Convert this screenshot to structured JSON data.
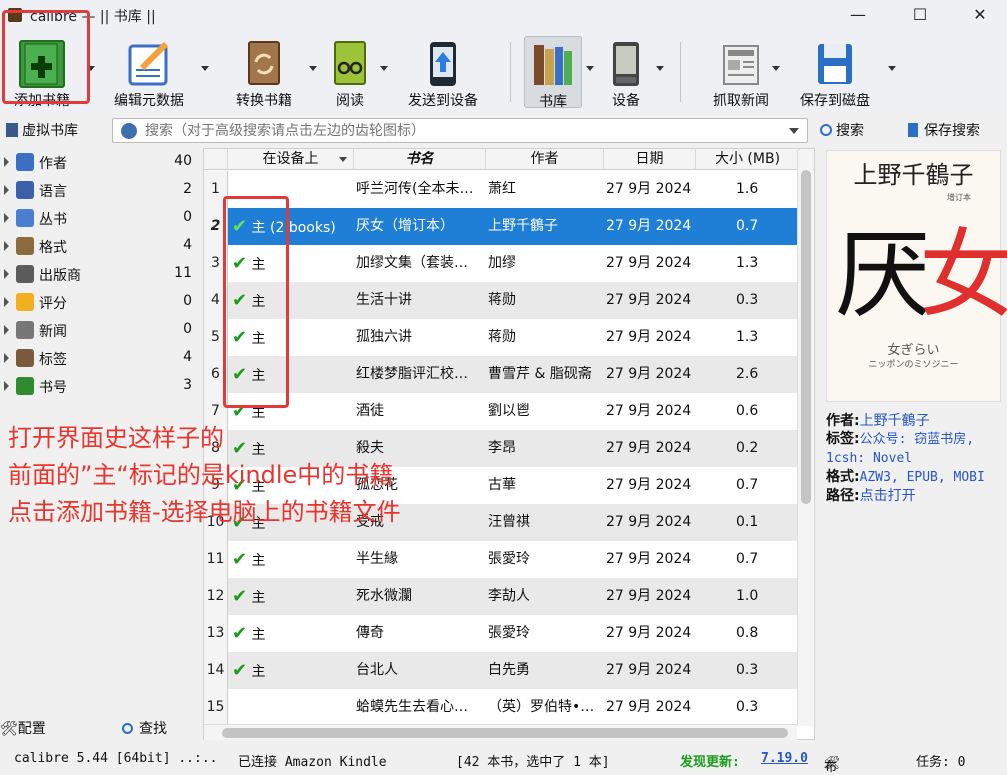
{
  "window": {
    "title": "calibre — || 书库 ||",
    "min": "—",
    "max": "☐",
    "close": "✕"
  },
  "toolbar": [
    {
      "id": "add",
      "label": "添加书籍",
      "icon": "add-book-icon"
    },
    {
      "id": "edit",
      "label": "编辑元数据",
      "icon": "edit-metadata-icon"
    },
    {
      "id": "convert",
      "label": "转换书籍",
      "icon": "convert-book-icon"
    },
    {
      "id": "view",
      "label": "阅读",
      "icon": "read-book-icon"
    },
    {
      "id": "send",
      "label": "发送到设备",
      "icon": "send-to-device-icon"
    },
    {
      "id": "library",
      "label": "书库",
      "icon": "library-icon"
    },
    {
      "id": "device",
      "label": "设备",
      "icon": "device-icon"
    },
    {
      "id": "news",
      "label": "抓取新闻",
      "icon": "news-icon"
    },
    {
      "id": "save",
      "label": "保存到磁盘",
      "icon": "save-disk-icon"
    }
  ],
  "search": {
    "virtual_library": "虚拟书库",
    "placeholder": "搜索（对于高级搜索请点击左边的齿轮图标）",
    "search_btn": "搜索",
    "saved_btn": "保存搜索"
  },
  "tags": [
    {
      "label": "作者",
      "count": "40",
      "color": "#3a6fc4"
    },
    {
      "label": "语言",
      "count": "2",
      "color": "#3b5fa8"
    },
    {
      "label": "丛书",
      "count": "0",
      "color": "#4a7ed0"
    },
    {
      "label": "格式",
      "count": "4",
      "color": "#8b6a3f"
    },
    {
      "label": "出版商",
      "count": "11",
      "color": "#5b5b5b"
    },
    {
      "label": "评分",
      "count": "0",
      "color": "#f2b01e"
    },
    {
      "label": "新闻",
      "count": "0",
      "color": "#777777"
    },
    {
      "label": "标签",
      "count": "4",
      "color": "#7a5a3a"
    },
    {
      "label": "书号",
      "count": "3",
      "color": "#2e8b2e"
    }
  ],
  "columns": {
    "device": "在设备上",
    "title": "书名",
    "author": "作者",
    "date": "日期",
    "size": "大小 (MB)"
  },
  "books": [
    {
      "n": "1",
      "dev": "",
      "title": "呼兰河传(全本未…",
      "author": "萧红",
      "date": "27 9月 2024",
      "size": "1.6"
    },
    {
      "n": "2",
      "dev": "主 (2 books)",
      "title": "厌女（增订本）",
      "author": "上野千鶴子",
      "date": "27 9月 2024",
      "size": "0.7"
    },
    {
      "n": "3",
      "dev": "主",
      "title": "加缪文集（套装…",
      "author": "加缪",
      "date": "27 9月 2024",
      "size": "1.3"
    },
    {
      "n": "4",
      "dev": "主",
      "title": "生活十讲",
      "author": "蒋勋",
      "date": "27 9月 2024",
      "size": "0.3"
    },
    {
      "n": "5",
      "dev": "主",
      "title": "孤独六讲",
      "author": "蒋勋",
      "date": "27 9月 2024",
      "size": "1.3"
    },
    {
      "n": "6",
      "dev": "主",
      "title": "红楼梦脂评汇校…",
      "author": "曹雪芹 & 脂砚斋",
      "date": "27 9月 2024",
      "size": "2.6"
    },
    {
      "n": "7",
      "dev": "主",
      "title": "酒徒",
      "author": "劉以鬯",
      "date": "27 9月 2024",
      "size": "0.6"
    },
    {
      "n": "8",
      "dev": "主",
      "title": "殺夫",
      "author": "李昂",
      "date": "27 9月 2024",
      "size": "0.2"
    },
    {
      "n": "9",
      "dev": "主",
      "title": "孤恋花",
      "author": "古華",
      "date": "27 9月 2024",
      "size": "0.7"
    },
    {
      "n": "10",
      "dev": "主",
      "title": "受戒",
      "author": "汪曾祺",
      "date": "27 9月 2024",
      "size": "0.1"
    },
    {
      "n": "11",
      "dev": "主",
      "title": "半生緣",
      "author": "張愛玲",
      "date": "27 9月 2024",
      "size": "0.7"
    },
    {
      "n": "12",
      "dev": "主",
      "title": "死水微瀾",
      "author": "李劼人",
      "date": "27 9月 2024",
      "size": "1.0"
    },
    {
      "n": "13",
      "dev": "主",
      "title": "傳奇",
      "author": "張愛玲",
      "date": "27 9月 2024",
      "size": "0.8"
    },
    {
      "n": "14",
      "dev": "主",
      "title": "台北人",
      "author": "白先勇",
      "date": "27 9月 2024",
      "size": "0.3"
    },
    {
      "n": "15",
      "dev": "",
      "title": "蛤蟆先生去看心…",
      "author": "（英）罗伯特•…",
      "date": "27 9月 2024",
      "size": "0.3"
    }
  ],
  "cover": {
    "author": "上野千鶴子",
    "title_a": "厌",
    "title_b": "女",
    "subtitle": "增订本",
    "jp_title": "女ぎらい",
    "jp_sub": "ニッポンのミソジニー"
  },
  "details": {
    "author_k": "作者:",
    "author_v": "上野千鶴子",
    "tags_k": "标签:",
    "tags_v": "公众号: 窃蓝书房, 1csh: Novel",
    "formats_k": "格式:",
    "formats_v": "AZW3, EPUB, MOBI",
    "path_k": "路径:",
    "path_v": "点击打开"
  },
  "bottom": {
    "config": "配置",
    "find": "查找"
  },
  "status": {
    "version": "calibre 5.44 [64bit] ..:..",
    "connected": "已连接 Amazon Kindle",
    "count": "[42 本书，选中了 1 本]",
    "update_label": "发现更新:",
    "update_ver": "7.19.0",
    "layout": "布局",
    "jobs": "任务:  0"
  },
  "annotation": {
    "line1": "打开界面史这样子的",
    "line2": "前面的”主“标记的是kindle中的书籍",
    "line3": "点击添加书籍-选择电脑上的书籍文件",
    "color": "#e03a3a"
  }
}
